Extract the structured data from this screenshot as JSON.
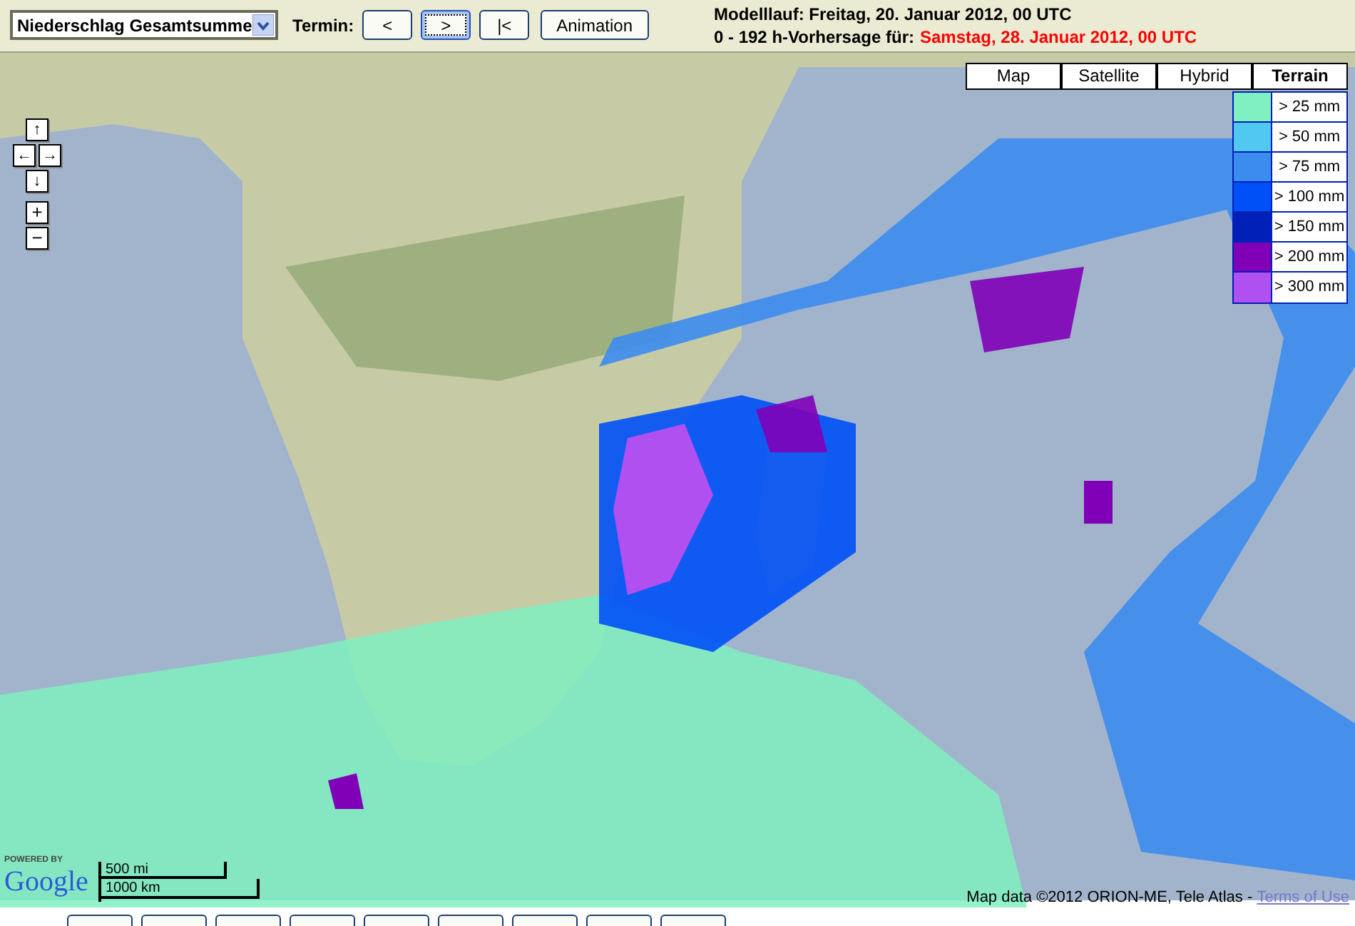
{
  "toolbar": {
    "product_select": {
      "value": "Niederschlag Gesamtsumme"
    },
    "termin_label": "Termin:",
    "buttons": [
      {
        "label": "<",
        "selected": false
      },
      {
        "label": ">",
        "selected": true
      },
      {
        "label": "|<",
        "selected": false
      },
      {
        "label": "Animation",
        "selected": false
      }
    ],
    "model_run": "Modelllauf: Freitag, 20. Januar 2012, 00 UTC",
    "forecast_prefix": "0 - 192 h-Vorhersage für:",
    "forecast_date": "Samstag, 28. Januar 2012, 00 UTC"
  },
  "map": {
    "pan_controls": [
      "↑",
      "←",
      "→",
      "↓"
    ],
    "zoom_controls": [
      "+",
      "−"
    ],
    "map_types": [
      {
        "label": "Map",
        "selected": false
      },
      {
        "label": "Satellite",
        "selected": false
      },
      {
        "label": "Hybrid",
        "selected": false
      },
      {
        "label": "Terrain",
        "selected": true
      }
    ],
    "legend": [
      {
        "label": "> 25 mm",
        "color": "#80f0c0"
      },
      {
        "label": "> 50 mm",
        "color": "#50c8f0"
      },
      {
        "label": "> 75 mm",
        "color": "#3c8cf0"
      },
      {
        "label": "> 100 mm",
        "color": "#0050f8"
      },
      {
        "label": "> 150 mm",
        "color": "#0020b8"
      },
      {
        "label": "> 200 mm",
        "color": "#8000b8"
      },
      {
        "label": "> 300 mm",
        "color": "#b050f0"
      }
    ],
    "powered_by": "POWERED BY",
    "logo": "Google",
    "scale": {
      "miles": "500 mi",
      "km": "1000 km"
    },
    "attribution": "Map data ©2012 ORION-ME, Tele Atlas - ",
    "terms_link": "Terms of Use"
  }
}
